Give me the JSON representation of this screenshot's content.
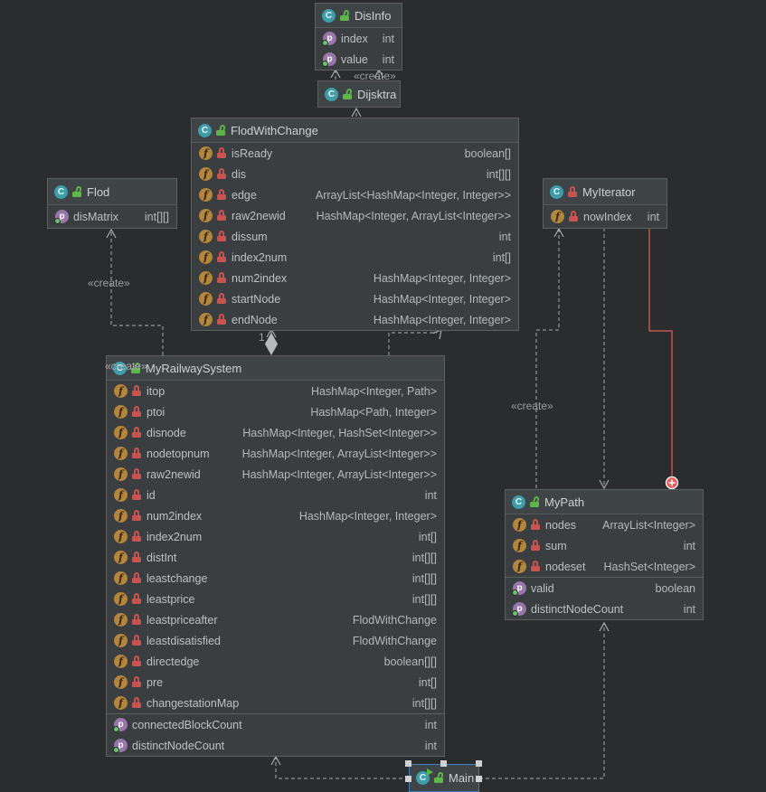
{
  "colors": {
    "red_edge": "#e0605f",
    "selection_blue": "#3d7dbf",
    "lock_green": "#5fb54a",
    "lock_red": "#c75450",
    "class_icon_teal": "#3f9daa",
    "field_icon_gold": "#b3853d",
    "property_icon_purple": "#9876aa"
  },
  "diagram": {
    "labels": {
      "create_top": "«create»",
      "create_left": "«create»",
      "create_right": "«create»",
      "create_overlap": "«create»",
      "multiplicity_one": "1"
    },
    "classes": [
      {
        "id": "disinfo",
        "name": "DisInfo",
        "lock": "open",
        "main_class": false,
        "fields": [
          {
            "name": "index",
            "type": "int",
            "icon": "p",
            "dot": true
          },
          {
            "name": "value",
            "type": "int",
            "icon": "p",
            "dot": true
          }
        ],
        "properties": []
      },
      {
        "id": "dijsktra",
        "name": "Dijsktra",
        "lock": "open",
        "main_class": false,
        "fields": [],
        "properties": []
      },
      {
        "id": "flodwithchange",
        "name": "FlodWithChange",
        "lock": "open",
        "main_class": false,
        "fields": [
          {
            "name": "isReady",
            "type": "boolean[]",
            "icon": "f",
            "lock": "closed"
          },
          {
            "name": "dis",
            "type": "int[][]",
            "icon": "f",
            "lock": "closed"
          },
          {
            "name": "edge",
            "type": "ArrayList<HashMap<Integer, Integer>>",
            "icon": "f",
            "lock": "closed"
          },
          {
            "name": "raw2newid",
            "type": "HashMap<Integer, ArrayList<Integer>>",
            "icon": "f",
            "lock": "closed"
          },
          {
            "name": "dissum",
            "type": "int",
            "icon": "f",
            "lock": "closed"
          },
          {
            "name": "index2num",
            "type": "int[]",
            "icon": "f",
            "lock": "closed"
          },
          {
            "name": "num2index",
            "type": "HashMap<Integer, Integer>",
            "icon": "f",
            "lock": "closed"
          },
          {
            "name": "startNode",
            "type": "HashMap<Integer, Integer>",
            "icon": "f",
            "lock": "closed"
          },
          {
            "name": "endNode",
            "type": "HashMap<Integer, Integer>",
            "icon": "f",
            "lock": "closed"
          }
        ],
        "properties": []
      },
      {
        "id": "flod",
        "name": "Flod",
        "lock": "open",
        "main_class": false,
        "fields": [
          {
            "name": "disMatrix",
            "type": "int[][]",
            "icon": "p",
            "dot": true
          }
        ],
        "properties": []
      },
      {
        "id": "myiterator",
        "name": "MyIterator",
        "lock": "closed",
        "main_class": false,
        "fields": [
          {
            "name": "nowIndex",
            "type": "int",
            "icon": "f",
            "lock": "closed"
          }
        ],
        "properties": []
      },
      {
        "id": "myrailwaysystem",
        "name": "MyRailwaySystem",
        "lock": "open",
        "main_class": false,
        "fields": [
          {
            "name": "itop",
            "type": "HashMap<Integer, Path>",
            "icon": "f",
            "lock": "closed"
          },
          {
            "name": "ptoi",
            "type": "HashMap<Path, Integer>",
            "icon": "f",
            "lock": "closed"
          },
          {
            "name": "disnode",
            "type": "HashMap<Integer, HashSet<Integer>>",
            "icon": "f",
            "lock": "closed"
          },
          {
            "name": "nodetopnum",
            "type": "HashMap<Integer, ArrayList<Integer>>",
            "icon": "f",
            "lock": "closed"
          },
          {
            "name": "raw2newid",
            "type": "HashMap<Integer, ArrayList<Integer>>",
            "icon": "f",
            "lock": "closed"
          },
          {
            "name": "id",
            "type": "int",
            "icon": "f",
            "lock": "closed"
          },
          {
            "name": "num2index",
            "type": "HashMap<Integer, Integer>",
            "icon": "f",
            "lock": "closed"
          },
          {
            "name": "index2num",
            "type": "int[]",
            "icon": "f",
            "lock": "closed"
          },
          {
            "name": "distInt",
            "type": "int[][]",
            "icon": "f",
            "lock": "closed"
          },
          {
            "name": "leastchange",
            "type": "int[][]",
            "icon": "f",
            "lock": "closed"
          },
          {
            "name": "leastprice",
            "type": "int[][]",
            "icon": "f",
            "lock": "closed"
          },
          {
            "name": "leastpriceafter",
            "type": "FlodWithChange",
            "icon": "f",
            "lock": "closed"
          },
          {
            "name": "leastdisatisfied",
            "type": "FlodWithChange",
            "icon": "f",
            "lock": "closed"
          },
          {
            "name": "directedge",
            "type": "boolean[][]",
            "icon": "f",
            "lock": "closed"
          },
          {
            "name": "pre",
            "type": "int[]",
            "icon": "f",
            "lock": "closed"
          },
          {
            "name": "changestationMap",
            "type": "int[][]",
            "icon": "f",
            "lock": "closed"
          }
        ],
        "properties": [
          {
            "name": "connectedBlockCount",
            "type": "int",
            "icon": "p",
            "dot": true
          },
          {
            "name": "distinctNodeCount",
            "type": "int",
            "icon": "p",
            "dot": true
          }
        ]
      },
      {
        "id": "mypath",
        "name": "MyPath",
        "lock": "open",
        "main_class": false,
        "fields": [
          {
            "name": "nodes",
            "type": "ArrayList<Integer>",
            "icon": "f",
            "lock": "closed"
          },
          {
            "name": "sum",
            "type": "int",
            "icon": "f",
            "lock": "closed"
          },
          {
            "name": "nodeset",
            "type": "HashSet<Integer>",
            "icon": "f",
            "lock": "closed"
          }
        ],
        "properties": [
          {
            "name": "valid",
            "type": "boolean",
            "icon": "p",
            "dot": true
          },
          {
            "name": "distinctNodeCount",
            "type": "int",
            "icon": "p",
            "dot": true
          }
        ]
      },
      {
        "id": "main",
        "name": "Main",
        "lock": "open",
        "main_class": true,
        "fields": [],
        "properties": []
      }
    ]
  }
}
